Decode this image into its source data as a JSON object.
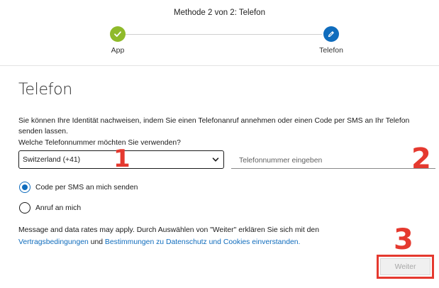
{
  "header": {
    "step_title": "Methode 2 von 2: Telefon",
    "steps": [
      {
        "label": "App",
        "state": "done",
        "color": "#8fba2a"
      },
      {
        "label": "Telefon",
        "state": "current",
        "color": "#0f6cbd"
      }
    ]
  },
  "main": {
    "title": "Telefon",
    "description": "Sie können Ihre Identität nachweisen, indem Sie einen Telefonanruf annehmen oder einen Code per SMS an Ihr Telefon senden lassen.",
    "question": "Welche Telefonnummer möchten Sie verwenden?",
    "country_select": {
      "value": "Switzerland (+41)"
    },
    "phone_input": {
      "value": "",
      "placeholder": "Telefonnummer eingeben"
    },
    "options": [
      {
        "label": "Code per SMS an mich senden",
        "selected": true
      },
      {
        "label": "Anruf an mich",
        "selected": false
      }
    ],
    "legal": {
      "text_before": "Message and data rates may apply. Durch Auswählen von \"Weiter\" erklären Sie sich mit den",
      "terms_link": "Vertragsbedingungen",
      "and": "und",
      "privacy_link": "Bestimmungen zu Datenschutz und Cookies",
      "text_after": "einverstanden."
    },
    "next_button": "Weiter"
  },
  "annotations": {
    "marker_1": "1",
    "marker_2": "2",
    "marker_3": "3",
    "color": "#e5392f"
  }
}
